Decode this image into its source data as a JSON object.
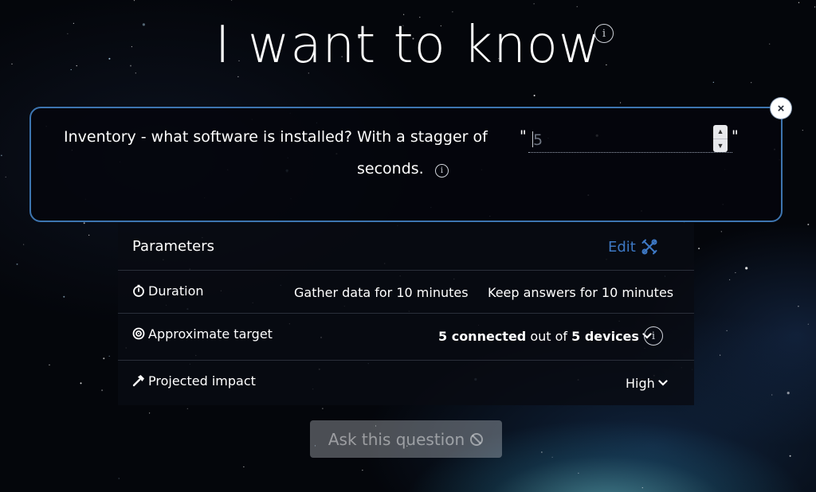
{
  "title": "I want to know",
  "question": {
    "text_before": "Inventory - what software is installed? With a stagger of",
    "quote_open": "\"",
    "quote_close": "\"",
    "stagger_value": "5",
    "text_after": "seconds."
  },
  "parameters": {
    "header": "Parameters",
    "edit_label": "Edit",
    "duration": {
      "label": "Duration",
      "gather": "Gather data for 10 minutes",
      "keep": "Keep answers for 10 minutes"
    },
    "target": {
      "label": "Approximate target",
      "connected": "5 connected",
      "out_of": " out of ",
      "devices": "5 devices"
    },
    "impact": {
      "label": "Projected impact",
      "value": "High"
    }
  },
  "ask_button_label": "Ask this question",
  "colors": {
    "accent": "#3d75b0",
    "link": "#3d78c4",
    "background": "#04060b"
  },
  "icons": {
    "title_info": "info-icon",
    "close": "close-icon",
    "duration": "stopwatch-icon",
    "target": "target-icon",
    "impact": "hammer-icon",
    "edit": "tools-icon",
    "ask": "no-entry-icon"
  }
}
